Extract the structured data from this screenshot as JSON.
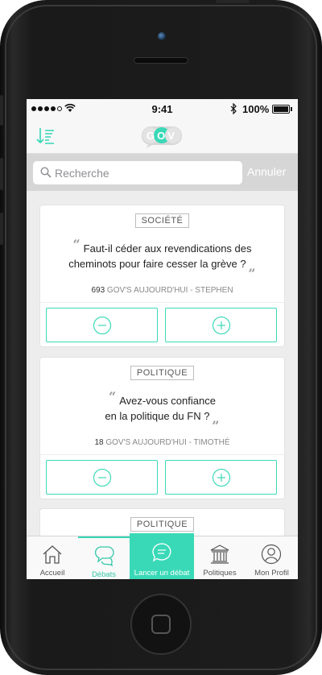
{
  "status_bar": {
    "time": "9:41",
    "battery_percent": "100%"
  },
  "nav": {
    "logo_text": "GOV"
  },
  "search": {
    "placeholder": "Recherche",
    "cancel_label": "Annuler"
  },
  "debates": [
    {
      "category": "SOCIÉTÉ",
      "question_line1": "Faut-il céder aux revendications des",
      "question_line2": "cheminots pour faire cesser la grève ?",
      "count": "693",
      "meta": "GOV'S AUJOURD'HUI - STEPHEN"
    },
    {
      "category": "POLITIQUE",
      "question_line1": "Avez-vous confiance",
      "question_line2": "en la politique du FN ?",
      "count": "18",
      "meta": "GOV'S AUJOURD'HUI - TIMOTHÉ"
    },
    {
      "category": "POLITIQUE"
    }
  ],
  "tabs": {
    "accueil": "Accueil",
    "debats": "Débats",
    "lancer": "Lancer un débat",
    "politiques": "Politiques",
    "profil": "Mon Profil"
  },
  "colors": {
    "accent": "#39d9b7",
    "vote_border": "#3dd9b9",
    "search_band": "#d6d6d6"
  }
}
